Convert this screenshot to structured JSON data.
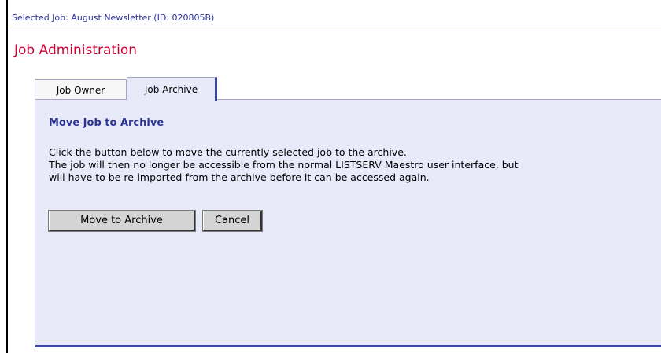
{
  "header": {
    "selected_job": "Selected Job: August Newsletter (ID: 020805B)",
    "page_title": "Job Administration"
  },
  "tabs": [
    {
      "label": "Job Owner",
      "active": false
    },
    {
      "label": "Job Archive",
      "active": true
    }
  ],
  "panel": {
    "title": "Move Job to Archive",
    "description_lines": [
      "Click the button below to move the currently selected job to the archive.",
      "The job will then no longer be accessible from the normal LISTSERV Maestro user interface, but",
      "will have to be re-imported from the archive before it can be accessed again."
    ],
    "buttons": {
      "move": "Move to Archive",
      "cancel": "Cancel"
    }
  },
  "colors": {
    "title_red": "#cc0033",
    "heading_blue": "#2b3592",
    "panel_bg": "#e8e9f9",
    "accent_border": "#3c47a4"
  }
}
